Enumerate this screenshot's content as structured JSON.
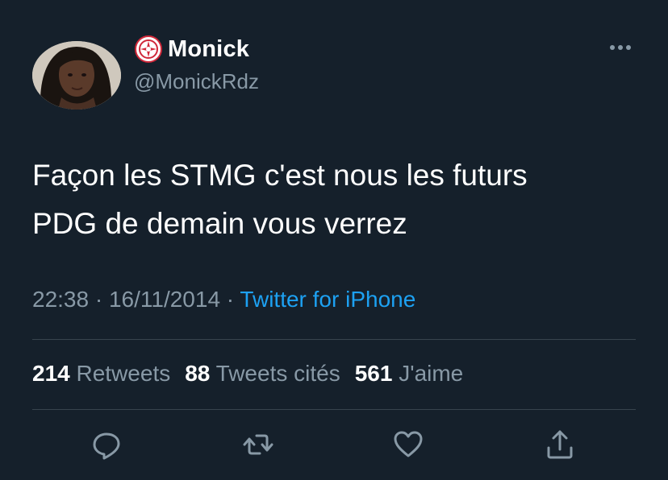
{
  "author": {
    "display_name": "Monick",
    "handle": "@MonickRdz"
  },
  "tweet": {
    "text_lines": [
      "Façon les STMG c'est nous les futurs",
      "PDG de demain vous verrez"
    ],
    "time": "22:38",
    "separator": " · ",
    "date": "16/11/2014",
    "source": "Twitter for iPhone"
  },
  "stats": {
    "retweets_count": "214",
    "retweets_label": "Retweets",
    "quotes_count": "88",
    "quotes_label": "Tweets cités",
    "likes_count": "561",
    "likes_label": "J'aime"
  },
  "colors": {
    "background": "#15202b",
    "text_primary": "#ffffff",
    "text_secondary": "#8899a6",
    "link": "#1da1f2",
    "divider": "#38444d"
  },
  "icons": {
    "badge": "red-emblem-badge-icon",
    "more": "more-horizontal-icon",
    "reply": "reply-icon",
    "retweet": "retweet-icon",
    "like": "heart-icon",
    "share": "share-icon"
  }
}
